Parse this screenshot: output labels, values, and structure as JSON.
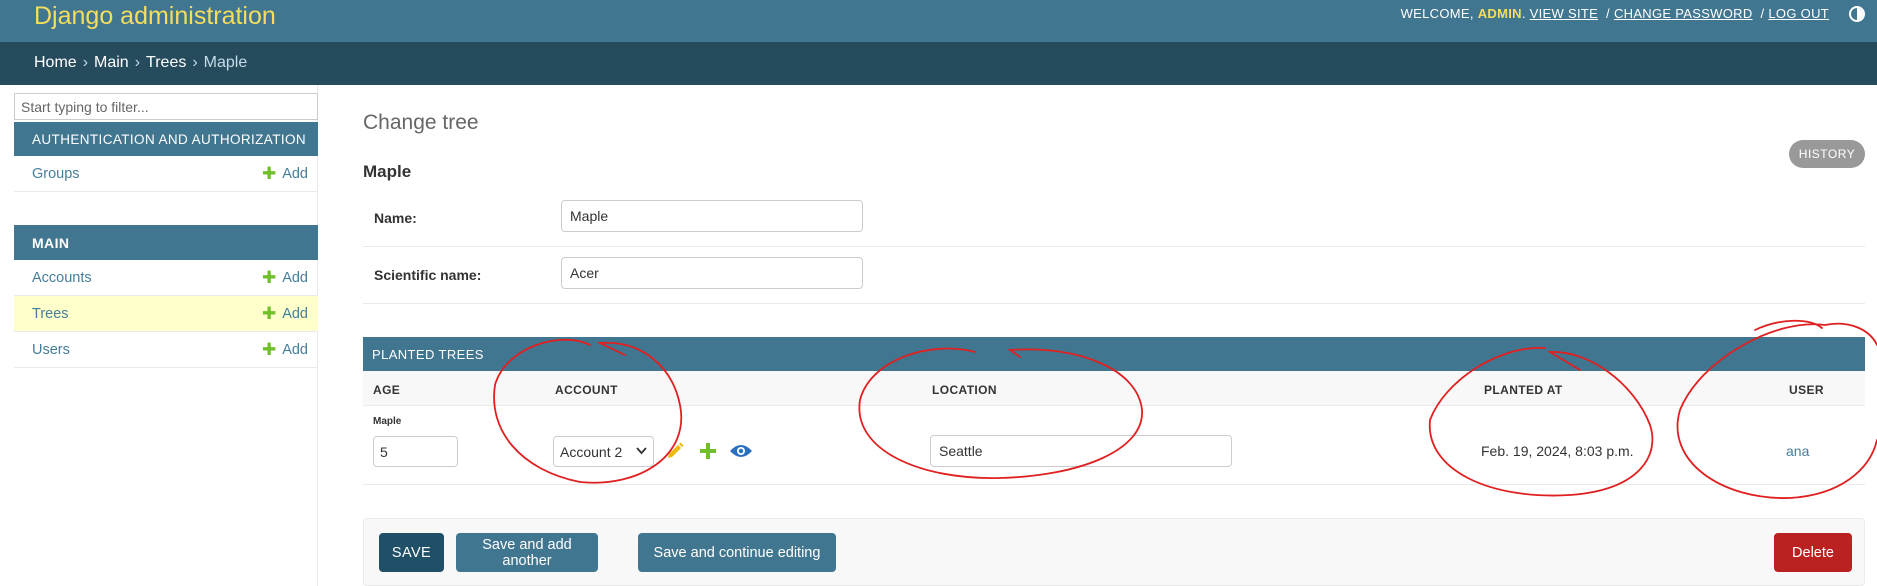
{
  "header": {
    "branding": "Django administration",
    "welcome": "WELCOME,",
    "username": "ADMIN",
    "view_site": "VIEW SITE",
    "change_password": "CHANGE PASSWORD",
    "log_out": "LOG OUT",
    "separator": "/"
  },
  "breadcrumbs": {
    "home": "Home",
    "app": "Main",
    "model": "Trees",
    "current": "Maple",
    "sep": "›"
  },
  "sidebar": {
    "filter_placeholder": "Start typing to filter...",
    "modules": [
      {
        "caption": "AUTHENTICATION AND AUTHORIZATION",
        "models": [
          {
            "name": "Groups",
            "add": "Add"
          }
        ]
      },
      {
        "caption": "MAIN",
        "models": [
          {
            "name": "Accounts",
            "add": "Add"
          },
          {
            "name": "Trees",
            "add": "Add",
            "active": true
          },
          {
            "name": "Users",
            "add": "Add"
          }
        ]
      }
    ],
    "collapse_glyph": "«"
  },
  "content": {
    "title": "Change tree",
    "history": "HISTORY",
    "object_heading": "Maple",
    "fields": {
      "name": {
        "label": "Name:",
        "value": "Maple"
      },
      "scientific_name": {
        "label": "Scientific name:",
        "value": "Acer"
      }
    }
  },
  "inline": {
    "caption": "PLANTED TREES",
    "headers": {
      "age": "AGE",
      "account": "ACCOUNT",
      "location": "LOCATION",
      "planted_at": "PLANTED AT",
      "user": "USER"
    },
    "rows": [
      {
        "original": "Maple",
        "age": "5",
        "account": "Account 2",
        "location": "Seattle",
        "planted_at": "Feb. 19, 2024, 8:03 p.m.",
        "user": "ana"
      }
    ]
  },
  "submit": {
    "save": "SAVE",
    "save_add_another": "Save and add another",
    "save_continue": "Save and continue editing",
    "delete": "Delete"
  },
  "colors": {
    "header": "#417690",
    "breadcrumbs": "#264b5d",
    "branding": "#f5dd5d",
    "link": "#447e9b",
    "add_icon": "#70bf2b",
    "change_icon": "#efb80b",
    "view_icon": "#2b70bf",
    "delete": "#ba2121",
    "annotation": "#e02020"
  },
  "icons": {
    "theme_toggle": "half-circle-icon",
    "add": "plus-icon",
    "change_related": "pencil-icon",
    "add_related": "plus-icon",
    "view_related": "eye-icon",
    "select": "chevron-down-icon"
  }
}
